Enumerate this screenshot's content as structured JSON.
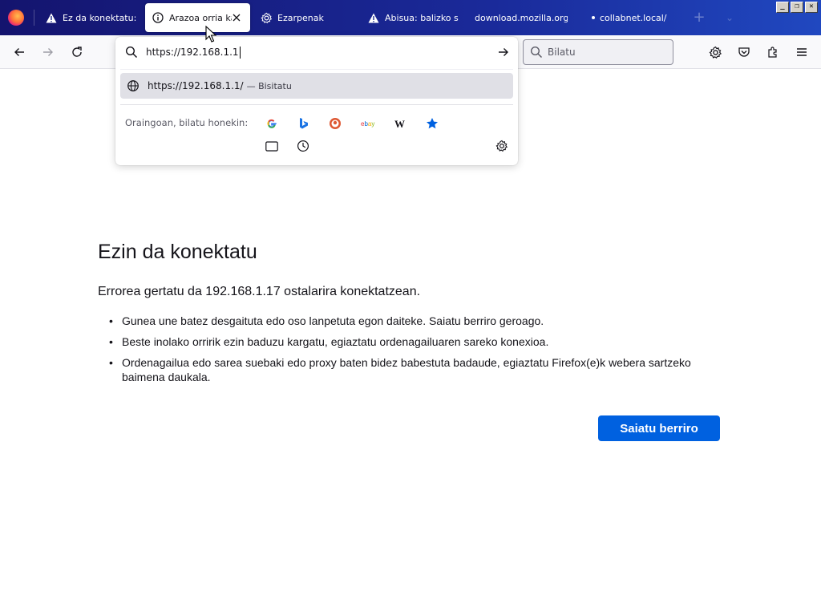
{
  "tabs": [
    {
      "label": "Ez da konektatu: b",
      "icon": "warning-icon"
    },
    {
      "label": "Arazoa orria ka",
      "icon": "info-icon",
      "active": true
    },
    {
      "label": "Ezarpenak",
      "icon": "gear-icon"
    },
    {
      "label": "Abisua: balizko seg",
      "icon": "warning-icon"
    },
    {
      "label": "download.mozilla.org/?",
      "icon": ""
    },
    {
      "label": "collabnet.local/",
      "icon": "dot-icon"
    }
  ],
  "window_controls": [
    "_",
    "❐",
    "✕"
  ],
  "urlbar": {
    "value": "https://192.168.1.1",
    "result_url": "https://192.168.1.1/",
    "result_desc": "— Bisitatu",
    "oneoff_label": "Oraingoan, bilatu honekin:"
  },
  "search_engines": [
    "google-icon",
    "bing-icon",
    "duckduckgo-icon",
    "ebay-icon",
    "wikipedia-icon",
    "bookmarks-star-icon",
    "tabs-icon",
    "history-icon"
  ],
  "search": {
    "placeholder": "Bilatu"
  },
  "error": {
    "title": "Ezin da konektatu",
    "lead": "Errorea gertatu da 192.168.1.17 ostalarira konektatzean.",
    "bullets": [
      "Gunea une batez desgaituta edo oso lanpetuta egon daiteke. Saiatu berriro geroago.",
      "Beste inolako orririk ezin baduzu kargatu, egiaztatu ordenagailuaren sareko konexioa.",
      "Ordenagailua edo sarea suebaki edo proxy baten bidez babestuta badaude, egiaztatu Firefox(e)k webera sartzeko baimena daukala."
    ],
    "retry_label": "Saiatu berriro"
  },
  "colors": {
    "accent": "#0061e0",
    "tabstrip": "#1a2a9a"
  }
}
